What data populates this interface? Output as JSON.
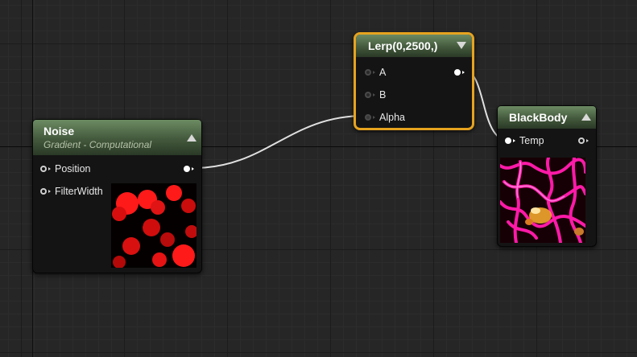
{
  "nodes": {
    "noise": {
      "title": "Noise",
      "subtitle": "Gradient - Computational",
      "inputs": [
        {
          "label": "Position"
        },
        {
          "label": "FilterWidth"
        }
      ]
    },
    "lerp": {
      "title": "Lerp(0,2500,)",
      "inputs": [
        {
          "label": "A"
        },
        {
          "label": "B"
        },
        {
          "label": "Alpha"
        }
      ]
    },
    "blackbody": {
      "title": "BlackBody",
      "inputs": [
        {
          "label": "Temp"
        }
      ]
    }
  },
  "colors": {
    "graph_background": "#262626",
    "header_green": "#43593c",
    "selection_outline": "#e6a31f",
    "wire": "#e0e0e0",
    "noise_red": "#ff1a1a",
    "blackbody_magenta": "#ff1aa8",
    "blackbody_orange": "#ffb030"
  },
  "icons": [
    "collapse-triangle-icon",
    "pin-icon",
    "output-pin-icon"
  ]
}
